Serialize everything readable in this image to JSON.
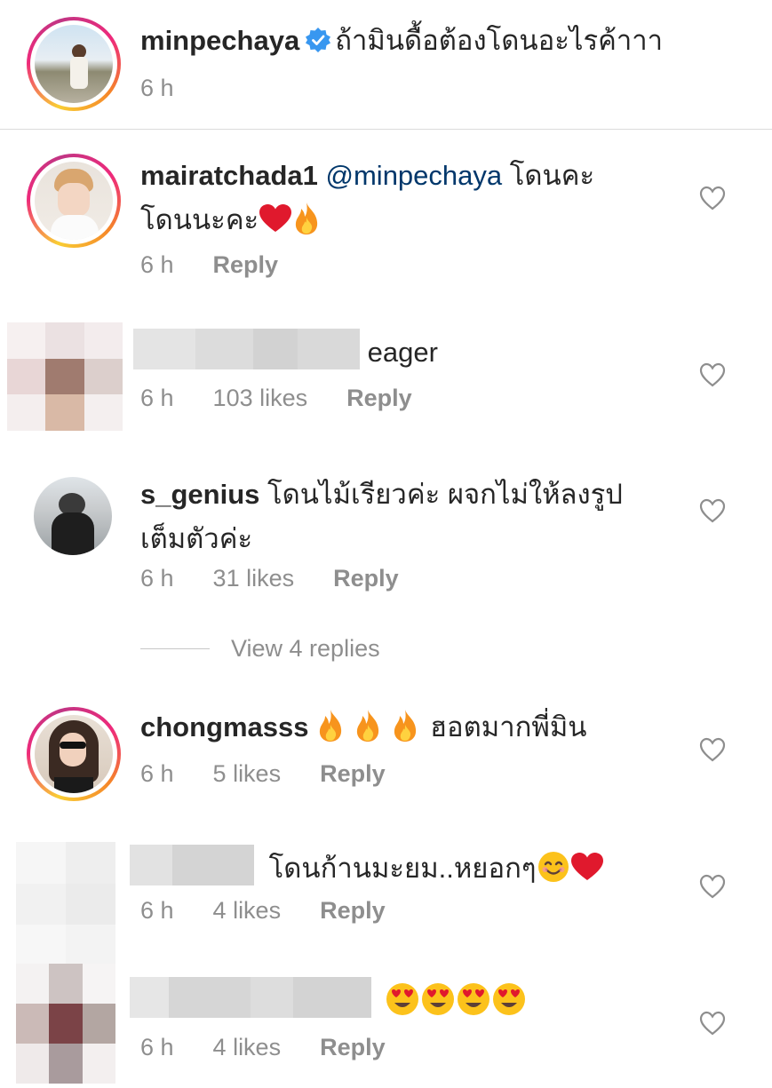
{
  "caption": {
    "username": "minpechaya",
    "text": "ถ้ามินดื้อต้องโดนอะไรค้าาา",
    "time": "6 h"
  },
  "comments": [
    {
      "username": "mairatchada1",
      "mention": "@minpechaya",
      "text_line1": "โดนคะ",
      "text_line2": "โดนนะคะ",
      "time": "6 h",
      "reply": "Reply"
    },
    {
      "text": "eager",
      "time": "6 h",
      "likes": "103 likes",
      "reply": "Reply"
    },
    {
      "username": "s_genius",
      "text_line1": "โดนไม้เรียวค่ะ ผจกไม่ให้ลงรูป",
      "text_line2": "เต็มตัวค่ะ",
      "time": "6 h",
      "likes": "31 likes",
      "reply": "Reply"
    },
    {
      "username": "chongmasss",
      "text": "ฮอตมากพี่มิน",
      "time": "6 h",
      "likes": "5 likes",
      "reply": "Reply"
    },
    {
      "text": "โดนก้านมะยม..หยอกๆ",
      "time": "6 h",
      "likes": "4 likes",
      "reply": "Reply"
    },
    {
      "text": "",
      "time": "6 h",
      "likes": "4 likes",
      "reply": "Reply"
    }
  ],
  "view_replies": "View 4 replies",
  "icons": [
    "verified-badge-icon",
    "heart-outline-icon",
    "red-heart-emoji",
    "fire-emoji",
    "smiling-face-emoji",
    "heart-eyes-emoji"
  ],
  "colors": {
    "verified_blue": "#3897f0",
    "mention_blue": "#00376b",
    "meta_gray": "#8e8e8e"
  }
}
